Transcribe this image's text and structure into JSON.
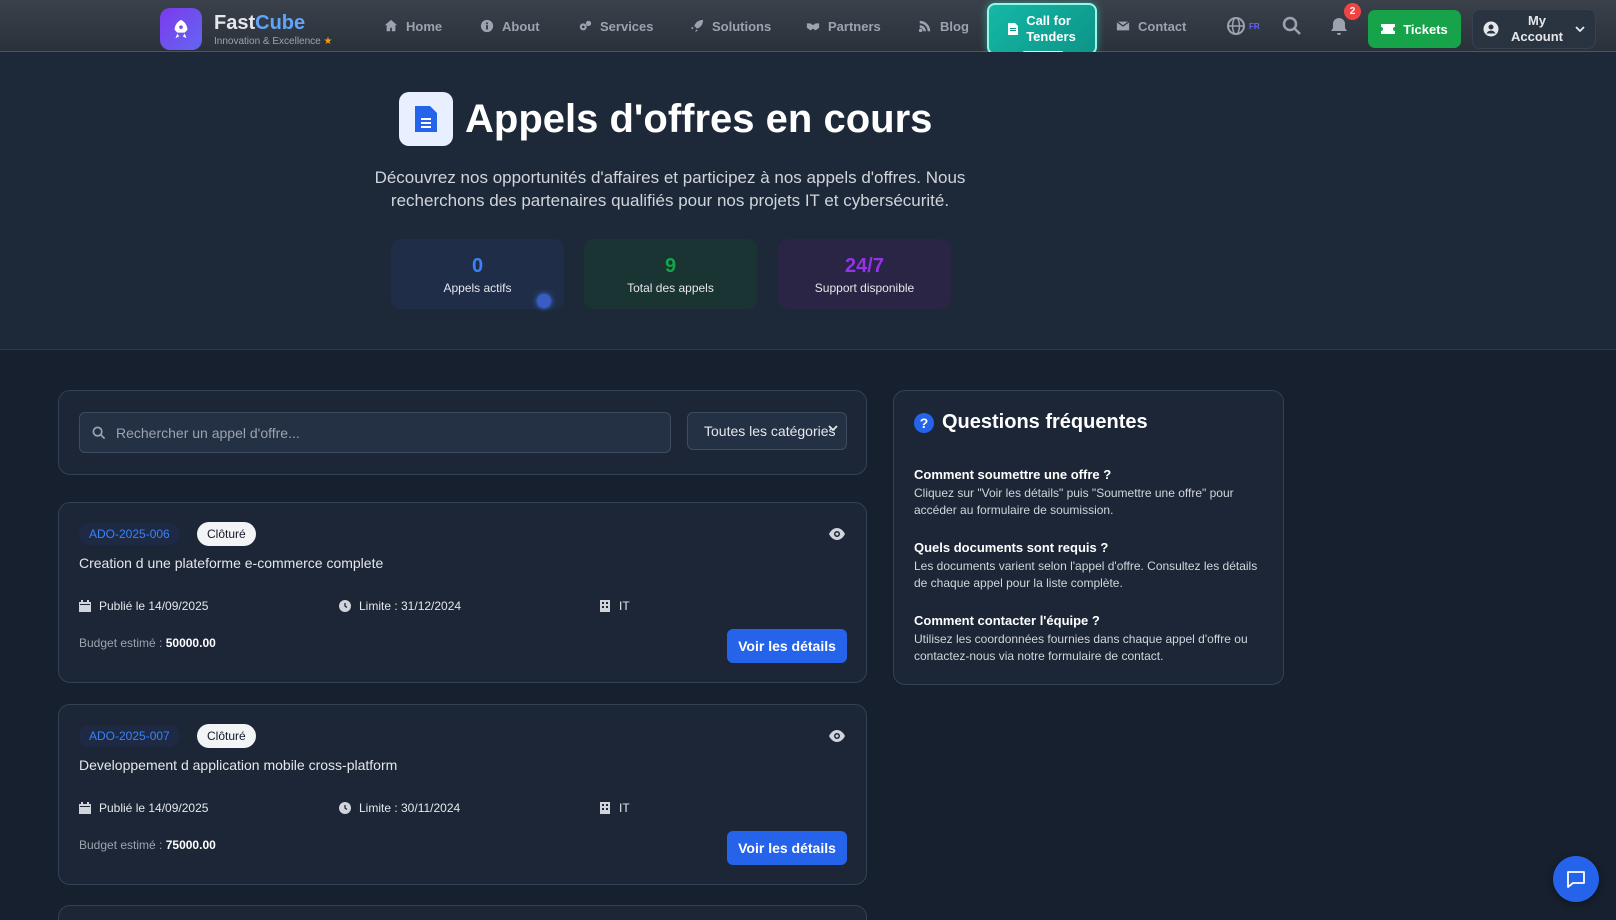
{
  "brand": {
    "name_part1": "Fast",
    "name_part2": "Cube",
    "tagline": "Innovation & Excellence"
  },
  "nav": {
    "items": [
      {
        "label": "Home",
        "icon": "home-icon"
      },
      {
        "label": "About",
        "icon": "info-icon"
      },
      {
        "label": "Services",
        "icon": "gears-icon"
      },
      {
        "label": "Solutions",
        "icon": "rocket-icon"
      },
      {
        "label": "Partners",
        "icon": "handshake-icon"
      },
      {
        "label": "Blog",
        "icon": "blog-icon"
      }
    ],
    "cta_line1": "Call for",
    "cta_line2": "Tenders",
    "contact_label": "Contact",
    "lang": "FR",
    "notifications_count": "2",
    "tickets_label": "Tickets",
    "account_line1": "My",
    "account_line2": "Account"
  },
  "hero": {
    "title": "Appels d'offres en cours",
    "description": "Découvrez nos opportunités d'affaires et participez à nos appels d'offres. Nous recherchons des partenaires qualifiés pour nos projets IT et cybersécurité.",
    "stats": [
      {
        "value": "0",
        "label": "Appels actifs",
        "color": "#3b82f6"
      },
      {
        "value": "9",
        "label": "Total des appels",
        "color": "#16a34a"
      },
      {
        "value": "24/7",
        "label": "Support disponible",
        "color": "#9333ea"
      }
    ]
  },
  "filters": {
    "search_placeholder": "Rechercher un appel d'offre...",
    "category_selected": "Toutes les catégories"
  },
  "tenders": [
    {
      "ref": "ADO-2025-006",
      "status": "Clôturé",
      "title": "Creation d une plateforme e-commerce complete",
      "published": "Publié le 14/09/2025",
      "deadline": "Limite : 31/12/2024",
      "category": "IT",
      "budget_label": "Budget estimé :",
      "budget_value": "50000.00",
      "button": "Voir les détails"
    },
    {
      "ref": "ADO-2025-007",
      "status": "Clôturé",
      "title": "Developpement d application mobile cross-platform",
      "published": "Publié le 14/09/2025",
      "deadline": "Limite : 30/11/2024",
      "category": "IT",
      "budget_label": "Budget estimé :",
      "budget_value": "75000.00",
      "button": "Voir les détails"
    }
  ],
  "faq": {
    "title": "Questions fréquentes",
    "items": [
      {
        "q": "Comment soumettre une offre ?",
        "a": "Cliquez sur \"Voir les détails\" puis \"Soumettre une offre\" pour accéder au formulaire de soumission."
      },
      {
        "q": "Quels documents sont requis ?",
        "a": "Les documents varient selon l'appel d'offre. Consultez les détails de chaque appel pour la liste complète."
      },
      {
        "q": "Comment contacter l'équipe ?",
        "a": "Utilisez les coordonnées fournies dans chaque appel d'offre ou contactez-nous via notre formulaire de contact."
      }
    ]
  },
  "colors": {
    "accent": "#2563eb",
    "cta": "#14b8a6",
    "success": "#16a34a",
    "danger": "#ef4444"
  }
}
